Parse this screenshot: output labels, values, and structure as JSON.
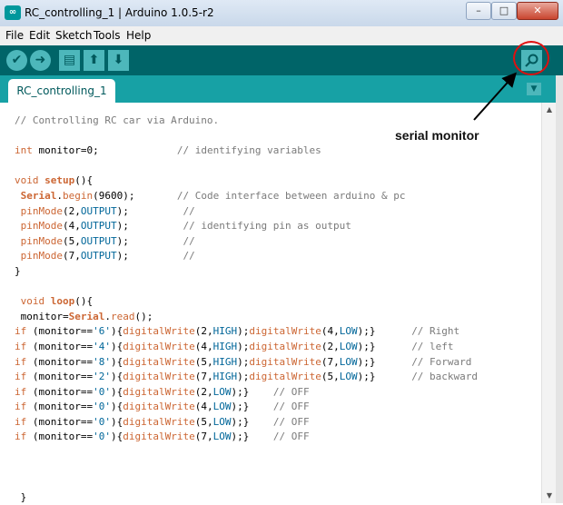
{
  "window": {
    "title": "RC_controlling_1 | Arduino 1.0.5-r2",
    "minimize_label": "–",
    "maximize_label": "□",
    "close_label": "✕"
  },
  "menu": [
    "File",
    "Edit",
    "Sketch",
    "Tools",
    "Help"
  ],
  "toolbar": {
    "verify_icon": "check-icon",
    "upload_icon": "right-arrow-icon",
    "new_icon": "document-icon",
    "open_icon": "up-arrow-icon",
    "save_icon": "down-arrow-icon",
    "serial_monitor_icon": "magnifier-icon"
  },
  "tab": {
    "label": "RC_controlling_1",
    "menu_icon": "triangle-down-icon"
  },
  "annotation": {
    "label": "serial monitor"
  },
  "code_lines": [
    [
      [
        "c",
        "// Controlling RC car via Arduino."
      ]
    ],
    [
      [
        "p",
        ""
      ]
    ],
    [
      [
        "k",
        "int"
      ],
      [
        "p",
        " monitor=0;             "
      ],
      [
        "c",
        "// identifying variables"
      ]
    ],
    [
      [
        "p",
        ""
      ]
    ],
    [
      [
        "k",
        "void"
      ],
      [
        "p",
        " "
      ],
      [
        "kb",
        "setup"
      ],
      [
        "p",
        "(){"
      ]
    ],
    [
      [
        "p",
        " "
      ],
      [
        "kb",
        "Serial"
      ],
      [
        "p",
        "."
      ],
      [
        "f",
        "begin"
      ],
      [
        "p",
        "(9600);       "
      ],
      [
        "c",
        "// Code interface between arduino & pc"
      ]
    ],
    [
      [
        "p",
        " "
      ],
      [
        "f",
        "pinMode"
      ],
      [
        "p",
        "(2,"
      ],
      [
        "n",
        "OUTPUT"
      ],
      [
        "p",
        ");         "
      ],
      [
        "c",
        "//"
      ]
    ],
    [
      [
        "p",
        " "
      ],
      [
        "f",
        "pinMode"
      ],
      [
        "p",
        "(4,"
      ],
      [
        "n",
        "OUTPUT"
      ],
      [
        "p",
        ");         "
      ],
      [
        "c",
        "// identifying pin as output"
      ]
    ],
    [
      [
        "p",
        " "
      ],
      [
        "f",
        "pinMode"
      ],
      [
        "p",
        "(5,"
      ],
      [
        "n",
        "OUTPUT"
      ],
      [
        "p",
        ");         "
      ],
      [
        "c",
        "//"
      ]
    ],
    [
      [
        "p",
        " "
      ],
      [
        "f",
        "pinMode"
      ],
      [
        "p",
        "(7,"
      ],
      [
        "n",
        "OUTPUT"
      ],
      [
        "p",
        ");         "
      ],
      [
        "c",
        "//"
      ]
    ],
    [
      [
        "p",
        "}"
      ]
    ],
    [
      [
        "p",
        ""
      ]
    ],
    [
      [
        "p",
        " "
      ],
      [
        "k",
        "void"
      ],
      [
        "p",
        " "
      ],
      [
        "kb",
        "loop"
      ],
      [
        "p",
        "(){"
      ]
    ],
    [
      [
        "p",
        " monitor="
      ],
      [
        "kb",
        "Serial"
      ],
      [
        "p",
        "."
      ],
      [
        "f",
        "read"
      ],
      [
        "p",
        "();"
      ]
    ],
    [
      [
        "k",
        "if"
      ],
      [
        "p",
        " (monitor=="
      ],
      [
        "s",
        "'6'"
      ],
      [
        "p",
        "){"
      ],
      [
        "f",
        "digitalWrite"
      ],
      [
        "p",
        "(2,"
      ],
      [
        "n",
        "HIGH"
      ],
      [
        "p",
        ");"
      ],
      [
        "f",
        "digitalWrite"
      ],
      [
        "p",
        "(4,"
      ],
      [
        "n",
        "LOW"
      ],
      [
        "p",
        ");}      "
      ],
      [
        "c",
        "// Right"
      ]
    ],
    [
      [
        "k",
        "if"
      ],
      [
        "p",
        " (monitor=="
      ],
      [
        "s",
        "'4'"
      ],
      [
        "p",
        "){"
      ],
      [
        "f",
        "digitalWrite"
      ],
      [
        "p",
        "(4,"
      ],
      [
        "n",
        "HIGH"
      ],
      [
        "p",
        ");"
      ],
      [
        "f",
        "digitalWrite"
      ],
      [
        "p",
        "(2,"
      ],
      [
        "n",
        "LOW"
      ],
      [
        "p",
        ");}      "
      ],
      [
        "c",
        "// left"
      ]
    ],
    [
      [
        "k",
        "if"
      ],
      [
        "p",
        " (monitor=="
      ],
      [
        "s",
        "'8'"
      ],
      [
        "p",
        "){"
      ],
      [
        "f",
        "digitalWrite"
      ],
      [
        "p",
        "(5,"
      ],
      [
        "n",
        "HIGH"
      ],
      [
        "p",
        ");"
      ],
      [
        "f",
        "digitalWrite"
      ],
      [
        "p",
        "(7,"
      ],
      [
        "n",
        "LOW"
      ],
      [
        "p",
        ");}      "
      ],
      [
        "c",
        "// Forward"
      ]
    ],
    [
      [
        "k",
        "if"
      ],
      [
        "p",
        " (monitor=="
      ],
      [
        "s",
        "'2'"
      ],
      [
        "p",
        "){"
      ],
      [
        "f",
        "digitalWrite"
      ],
      [
        "p",
        "(7,"
      ],
      [
        "n",
        "HIGH"
      ],
      [
        "p",
        ");"
      ],
      [
        "f",
        "digitalWrite"
      ],
      [
        "p",
        "(5,"
      ],
      [
        "n",
        "LOW"
      ],
      [
        "p",
        ");}      "
      ],
      [
        "c",
        "// backward"
      ]
    ],
    [
      [
        "k",
        "if"
      ],
      [
        "p",
        " (monitor=="
      ],
      [
        "s",
        "'0'"
      ],
      [
        "p",
        "){"
      ],
      [
        "f",
        "digitalWrite"
      ],
      [
        "p",
        "(2,"
      ],
      [
        "n",
        "LOW"
      ],
      [
        "p",
        ");}    "
      ],
      [
        "c",
        "// OFF"
      ]
    ],
    [
      [
        "k",
        "if"
      ],
      [
        "p",
        " (monitor=="
      ],
      [
        "s",
        "'0'"
      ],
      [
        "p",
        "){"
      ],
      [
        "f",
        "digitalWrite"
      ],
      [
        "p",
        "(4,"
      ],
      [
        "n",
        "LOW"
      ],
      [
        "p",
        ");}    "
      ],
      [
        "c",
        "// OFF"
      ]
    ],
    [
      [
        "k",
        "if"
      ],
      [
        "p",
        " (monitor=="
      ],
      [
        "s",
        "'0'"
      ],
      [
        "p",
        "){"
      ],
      [
        "f",
        "digitalWrite"
      ],
      [
        "p",
        "(5,"
      ],
      [
        "n",
        "LOW"
      ],
      [
        "p",
        ");}    "
      ],
      [
        "c",
        "// OFF"
      ]
    ],
    [
      [
        "k",
        "if"
      ],
      [
        "p",
        " (monitor=="
      ],
      [
        "s",
        "'0'"
      ],
      [
        "p",
        "){"
      ],
      [
        "f",
        "digitalWrite"
      ],
      [
        "p",
        "(7,"
      ],
      [
        "n",
        "LOW"
      ],
      [
        "p",
        ");}    "
      ],
      [
        "c",
        "// OFF"
      ]
    ],
    [
      [
        "p",
        ""
      ]
    ],
    [
      [
        "p",
        ""
      ]
    ],
    [
      [
        "p",
        ""
      ]
    ],
    [
      [
        "p",
        " }"
      ]
    ]
  ],
  "colors": {
    "toolbar_bg": "#006468",
    "tab_bar_bg": "#17a1a5",
    "button_fill": "#4db7bb",
    "keyword": "#cc6633",
    "constant": "#006699",
    "comment": "#7a7a7a",
    "annotation_circle": "#e01010"
  }
}
